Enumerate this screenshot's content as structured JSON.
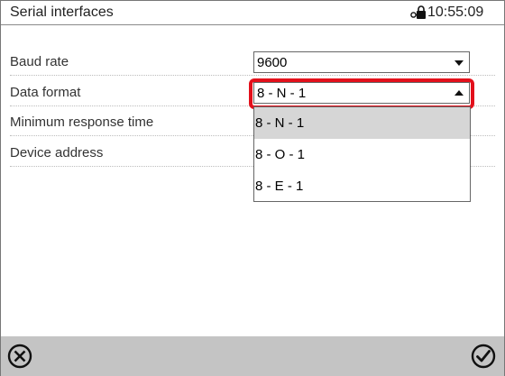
{
  "window": {
    "title": "Serial interfaces",
    "time": "10:55:09"
  },
  "settings": [
    {
      "label": "Baud rate",
      "value": "9600",
      "control": "select"
    },
    {
      "label": "Data format",
      "value": "8 - N - 1",
      "control": "select-open"
    },
    {
      "label": "Minimum response time"
    },
    {
      "label": "Device address"
    }
  ],
  "dropdown": {
    "options": [
      "8 - N - 1",
      "8 - O - 1",
      "8 - E - 1"
    ],
    "selected": "8 - N - 1"
  },
  "icons": {
    "lock": "lock-key-icon",
    "cancel": "close-circle-icon",
    "confirm": "check-circle-icon"
  },
  "colors": {
    "highlight": "#e3101b",
    "bottom_bar": "#c4c4c4",
    "selected_option": "#d6d6d6"
  }
}
